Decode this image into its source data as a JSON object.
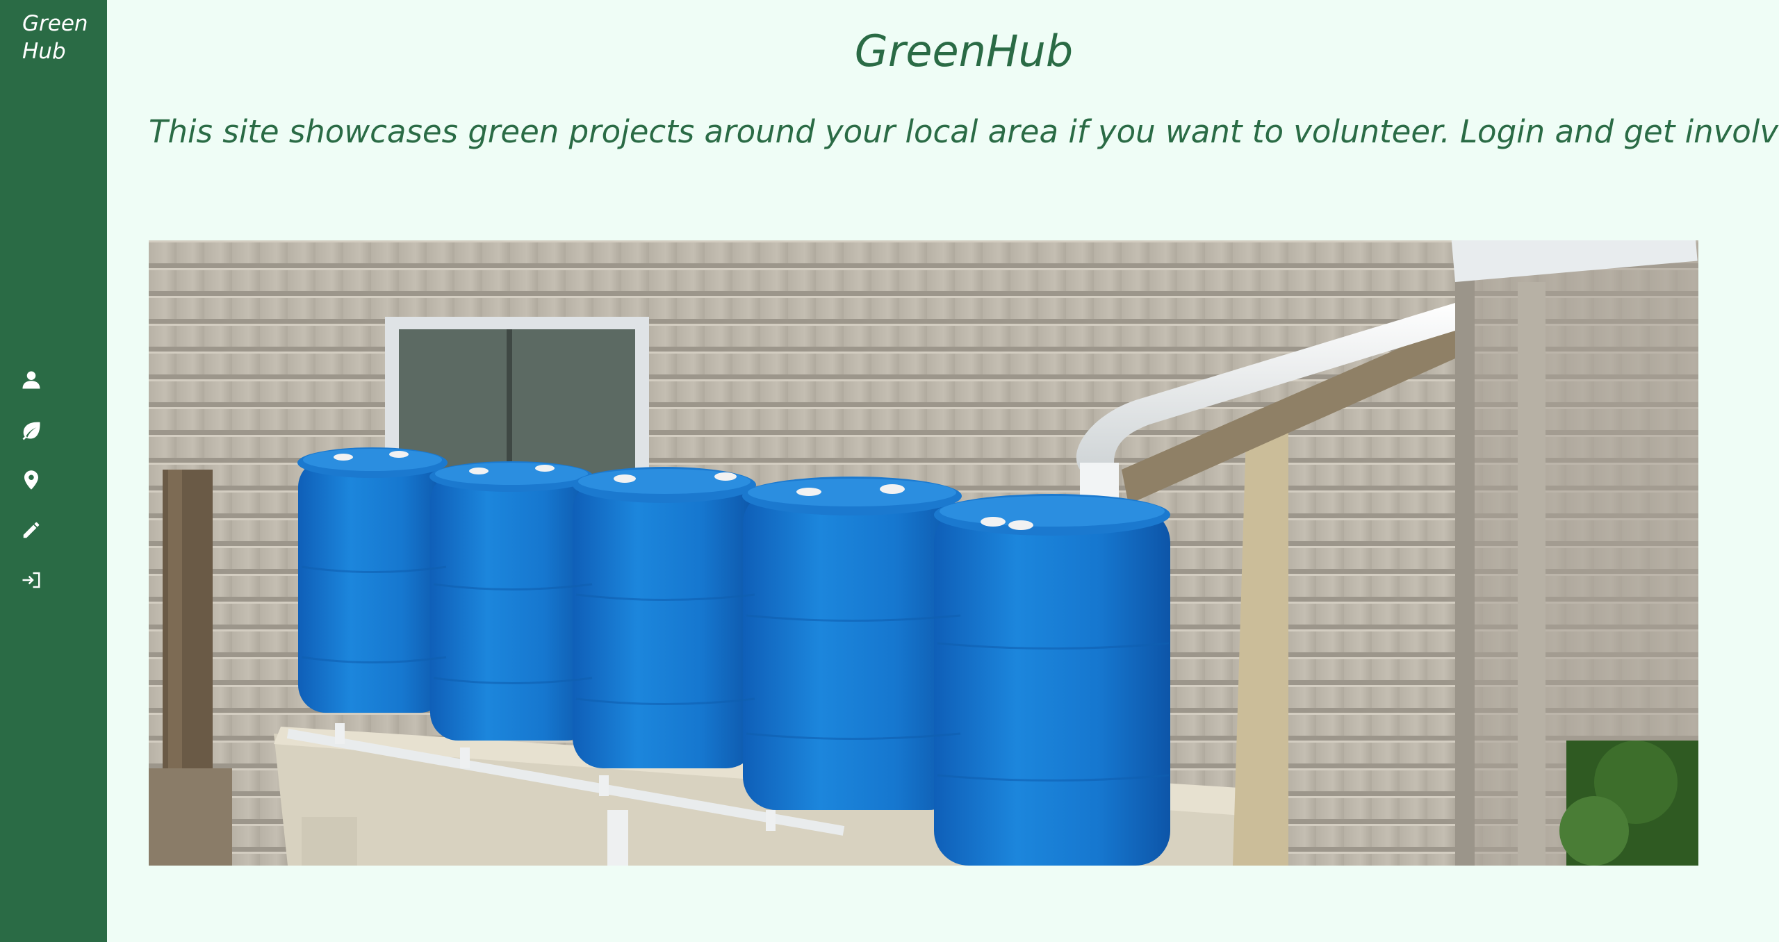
{
  "sidebar": {
    "brand": "Green Hub",
    "items": [
      {
        "icon": "user-icon",
        "label": ""
      },
      {
        "icon": "leaf-icon",
        "label": ""
      },
      {
        "icon": "map-marker-icon",
        "label": ""
      },
      {
        "icon": "pencil-icon",
        "label": ""
      },
      {
        "icon": "sign-in-icon",
        "label": ""
      }
    ]
  },
  "header": {
    "title": "GreenHub",
    "tagline": "This site showcases green projects around your local area if you want to volunteer. Login and get involved."
  },
  "hero": {
    "alt": "Blue rain barrels connected to a downspout beside a house"
  },
  "colors": {
    "sidebar_bg": "#2a6b45",
    "page_bg": "#effdf6",
    "text": "#2a6b45",
    "barrel": "#1a7fd4"
  }
}
